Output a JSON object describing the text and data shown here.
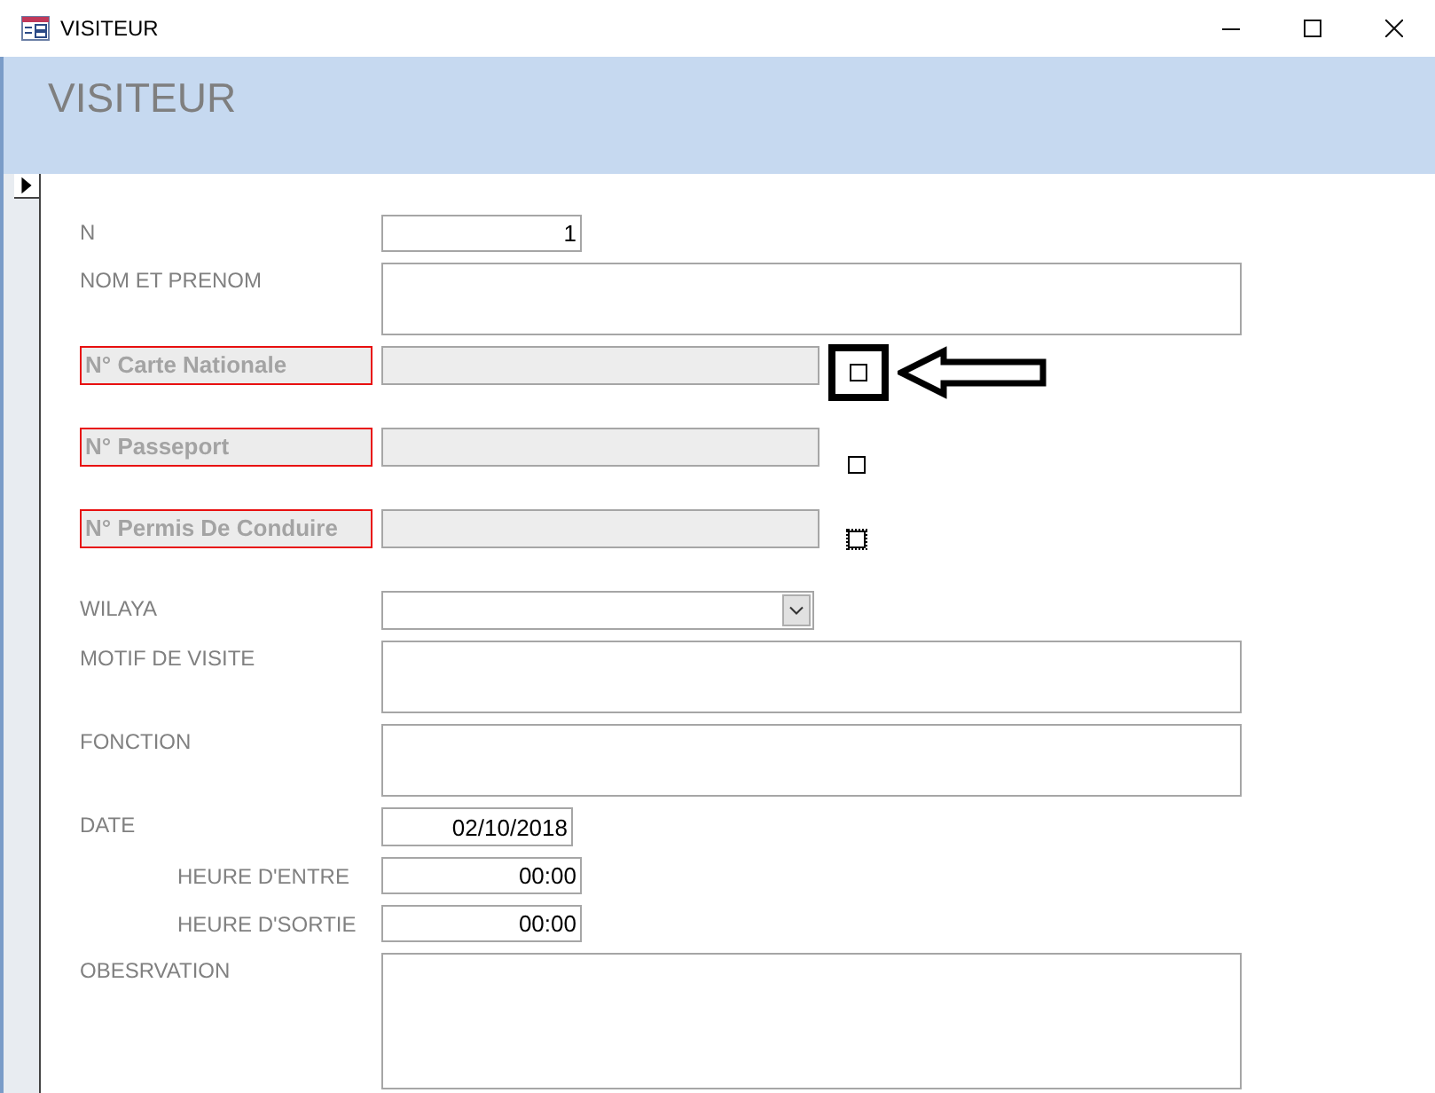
{
  "window": {
    "title": "VISITEUR"
  },
  "header": {
    "title": "VISITEUR"
  },
  "record_selector": {
    "current": true
  },
  "fields": [
    {
      "kind": "number",
      "label": "N",
      "value": "1",
      "disabled": false
    },
    {
      "kind": "multiline",
      "label": "NOM ET PRENOM",
      "disabled": false
    },
    {
      "kind": "id",
      "label": "N° Carte Nationale",
      "disabled": true,
      "checkbox": {
        "checked": false,
        "focused": false,
        "highlighted": true
      }
    },
    {
      "kind": "id",
      "label": "N° Passeport",
      "disabled": true,
      "checkbox": {
        "checked": false,
        "focused": false,
        "highlighted": false
      }
    },
    {
      "kind": "id",
      "label": "N° Permis De Conduire",
      "disabled": true,
      "checkbox": {
        "checked": false,
        "focused": true,
        "highlighted": false
      }
    },
    {
      "kind": "combo",
      "label": "WILAYA",
      "disabled": false
    },
    {
      "kind": "multiline",
      "label": "MOTIF DE VISITE",
      "disabled": false
    },
    {
      "kind": "multiline",
      "label": "FONCTION",
      "disabled": false
    },
    {
      "kind": "date",
      "label": "DATE",
      "value": "02/10/2018",
      "disabled": false
    },
    {
      "kind": "time",
      "label": "HEURE D'ENTRE",
      "value": "00:00",
      "disabled": false
    },
    {
      "kind": "time",
      "label": "HEURE D'SORTIE",
      "value": "00:00",
      "disabled": false
    },
    {
      "kind": "memo",
      "label": "OBESRVATION",
      "disabled": false
    }
  ]
}
